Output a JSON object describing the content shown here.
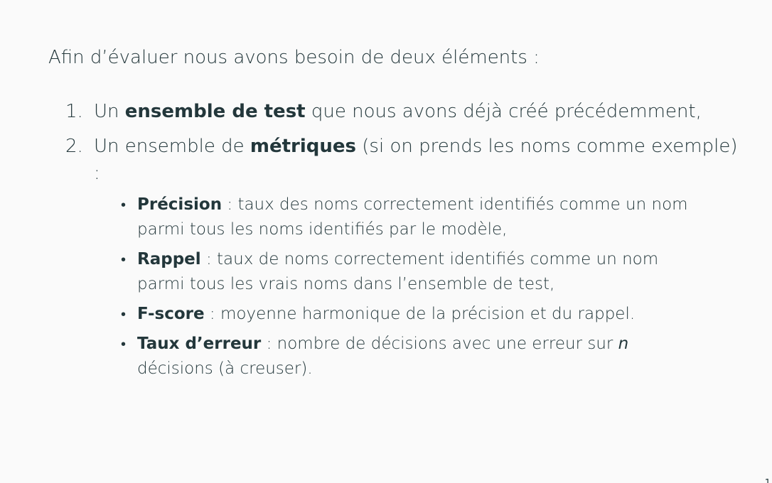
{
  "intro": "Afin d’évaluer nous avons besoin de deux éléments :",
  "list": [
    {
      "number": "1.",
      "before": "Un ",
      "bold": "ensemble de test",
      "after": " que nous avons déjà créé précédemment,"
    },
    {
      "number": "2.",
      "before": "Un ensemble de ",
      "bold": "métriques",
      "after": " (si on prends les noms comme exemple) :",
      "sub_items": [
        {
          "bullet": "•",
          "term": "Précision",
          "text": " : taux des noms correctement identifiés comme un nom parmi tous les noms identifiés par le modèle,"
        },
        {
          "bullet": "•",
          "term": "Rappel",
          "text": " : taux de noms correctement identifiés comme un nom parmi tous les vrais noms dans l’ensemble de test,"
        },
        {
          "bullet": "•",
          "term": "F-score",
          "text": " : moyenne harmonique de la précision et du rappel."
        },
        {
          "bullet": "•",
          "term": "Taux d’erreur",
          "text": " : nombre de décisions avec une erreur sur ",
          "italic": "n",
          "text_end": " décisions (à creuser)."
        }
      ]
    }
  ],
  "page_number": "1"
}
